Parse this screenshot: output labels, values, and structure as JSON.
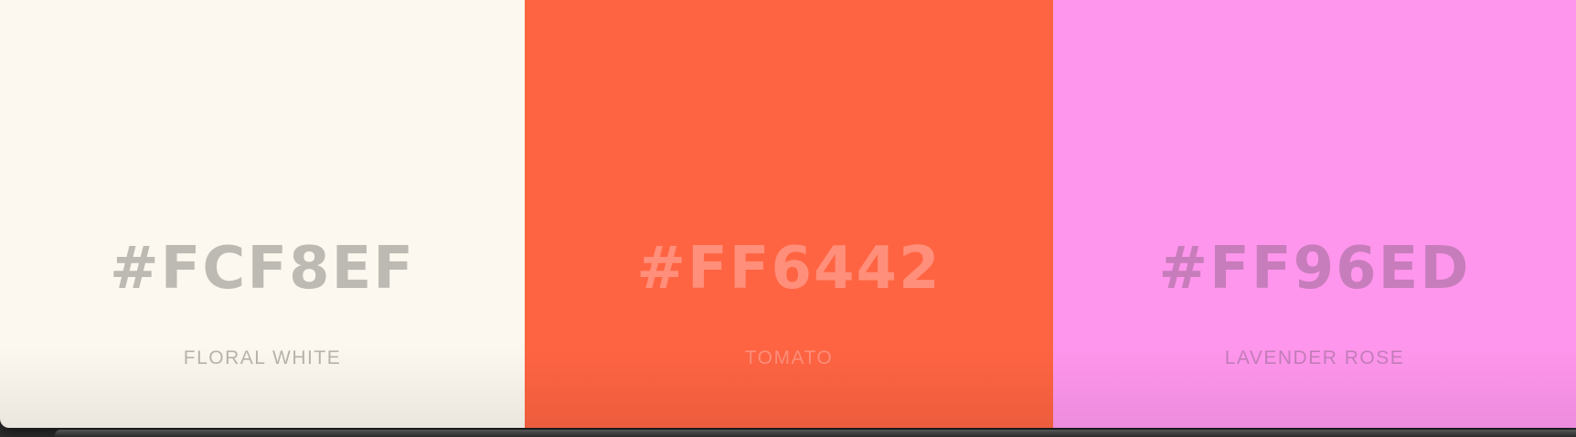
{
  "swatches": [
    {
      "hex": "#FCF8EF",
      "name": "FLORAL WHITE",
      "background": "#FCF8EF",
      "hex_color": "#BDBAB4",
      "name_color": "#B7B4AE"
    },
    {
      "hex": "#FF6442",
      "name": "TOMATO",
      "background": "#FF6442",
      "hex_color": "#FF8F7A",
      "name_color": "#FF8F7A"
    },
    {
      "hex": "#FF96ED",
      "name": "LAVENDER ROSE",
      "background": "#FF96ED",
      "hex_color": "#C77DBB",
      "name_color": "#C47EBA"
    }
  ]
}
